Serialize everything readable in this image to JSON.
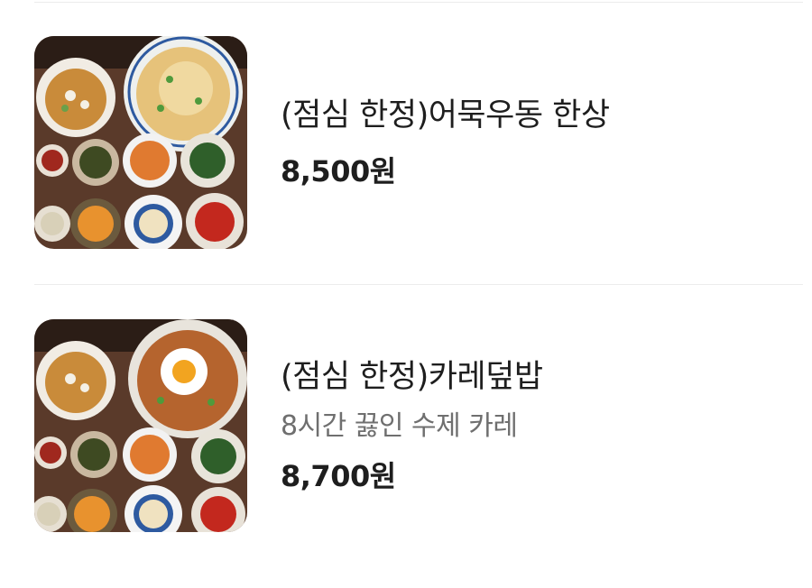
{
  "menu": {
    "items": [
      {
        "name": "(점심 한정)어묵우동 한상",
        "price": "8,500원",
        "image_icon": "udon-set-photo"
      },
      {
        "name": "(점심 한정)카레덮밥",
        "description": "8시간 끓인 수제 카레",
        "price": "8,700원",
        "image_icon": "curry-rice-set-photo"
      }
    ]
  },
  "colors": {
    "text_primary": "#1e1e1e",
    "text_secondary": "#6f6f6f",
    "divider": "#ececec",
    "table_wood": "#5a3a2a"
  }
}
